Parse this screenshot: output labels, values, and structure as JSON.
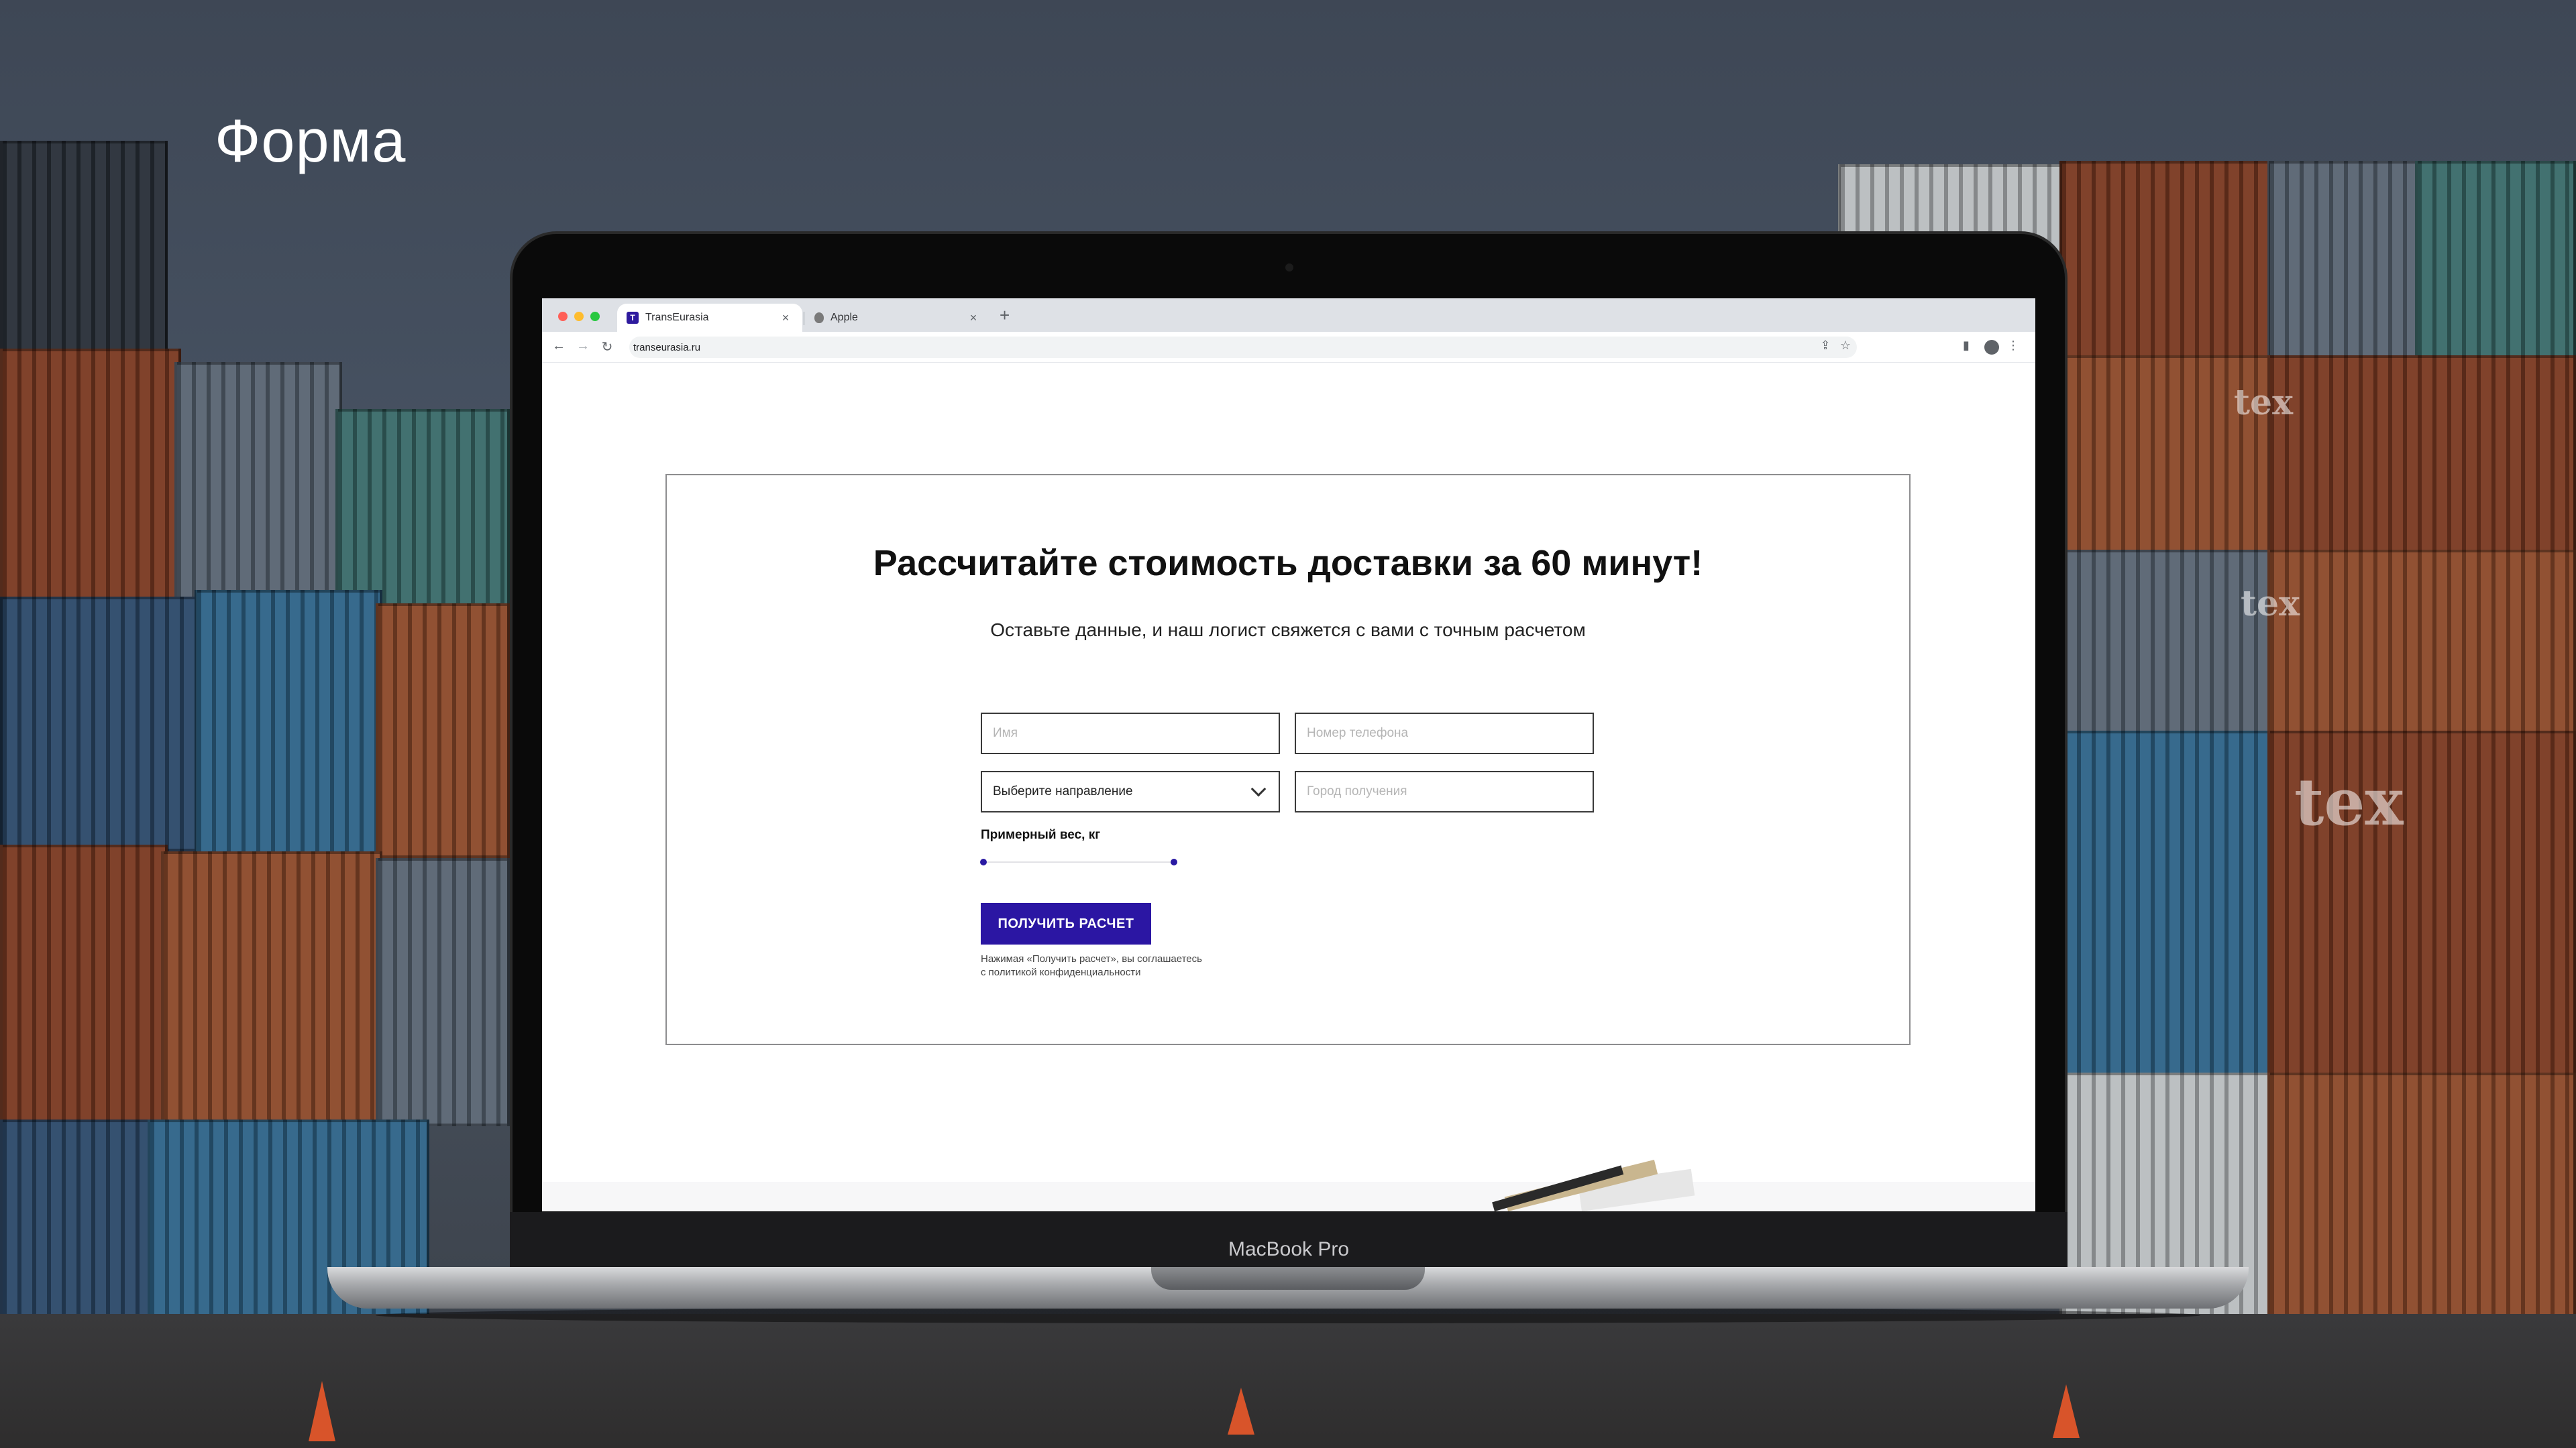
{
  "slide": {
    "heading": "Форма"
  },
  "laptop": {
    "brand": "MacBook Pro"
  },
  "browser": {
    "tabs": [
      {
        "title": "TransEurasia",
        "favicon": "T",
        "active": true
      },
      {
        "title": "Apple",
        "favicon": "apple-icon",
        "active": false
      }
    ],
    "new_tab": "+",
    "close_glyph": "×",
    "url": "transeurasia.ru"
  },
  "form": {
    "title": "Рассчитайте стоимость доставки за 60 минут!",
    "subtitle": "Оставьте данные, и наш логист свяжется с вами с точным расчетом",
    "name_placeholder": "Имя",
    "phone_placeholder": "Номер телефона",
    "direction_selected": "Выберите направление",
    "city_placeholder": "Город получения",
    "weight_label": "Примерный вес, кг",
    "weight_range": [
      0.0,
      1.0
    ],
    "submit_label": "ПОЛУЧИТЬ РАСЧЕТ",
    "consent_line1": "Нажимая «Получить расчет», вы соглашаетесь",
    "consent_line2": "с политикой конфиденциальности"
  },
  "colors": {
    "accent": "#2b16a3",
    "page_bg": "#ffffff",
    "border": "#3a3a3a"
  }
}
